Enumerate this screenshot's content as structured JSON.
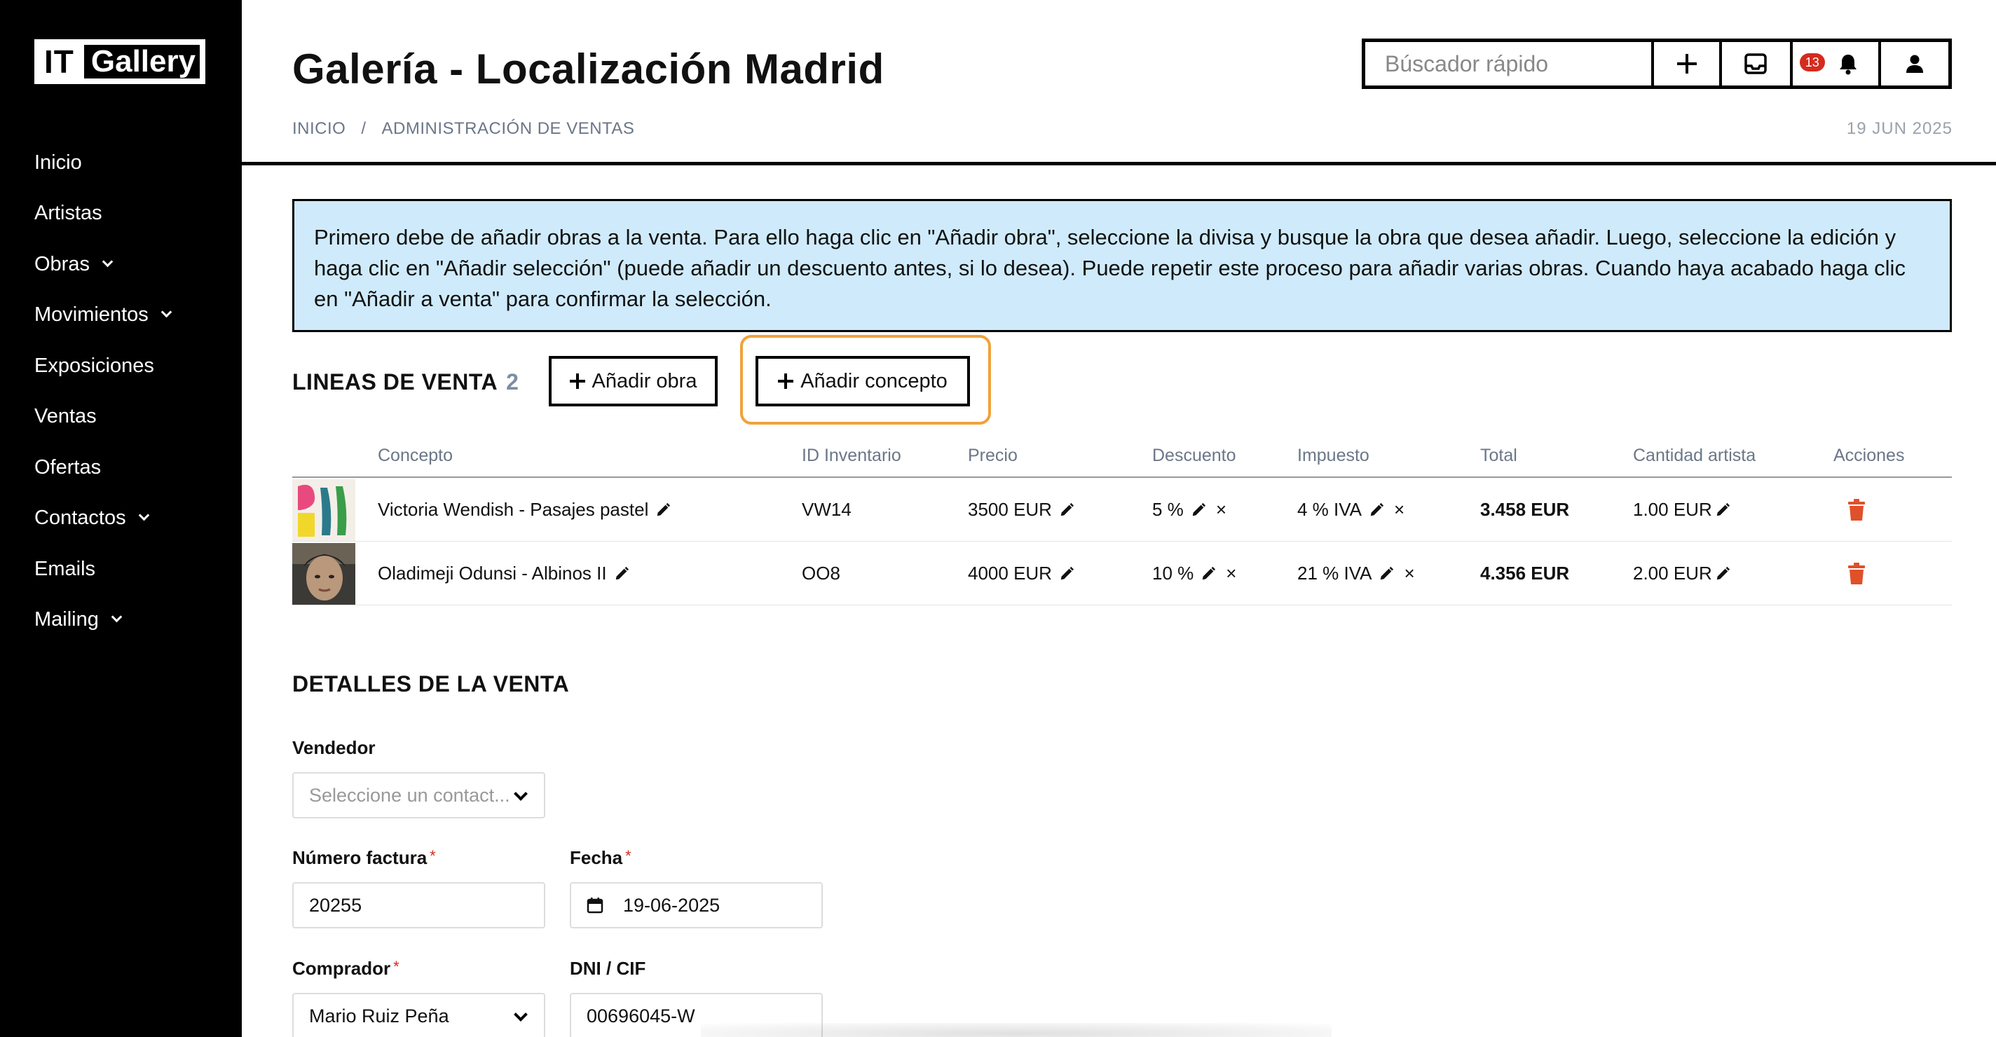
{
  "app": {
    "logo_it": "IT",
    "logo_gallery": "Gallery"
  },
  "sidebar": {
    "items": [
      {
        "label": "Inicio",
        "has_submenu": false
      },
      {
        "label": "Artistas",
        "has_submenu": false
      },
      {
        "label": "Obras",
        "has_submenu": true
      },
      {
        "label": "Movimientos",
        "has_submenu": true
      },
      {
        "label": "Exposiciones",
        "has_submenu": false
      },
      {
        "label": "Ventas",
        "has_submenu": false
      },
      {
        "label": "Ofertas",
        "has_submenu": false
      },
      {
        "label": "Contactos",
        "has_submenu": true
      },
      {
        "label": "Emails",
        "has_submenu": false
      },
      {
        "label": "Mailing",
        "has_submenu": true
      }
    ]
  },
  "header": {
    "title": "Galería - Localización Madrid",
    "breadcrumb": [
      "INICIO",
      "ADMINISTRACIÓN DE VENTAS"
    ],
    "breadcrumb_sep": "/",
    "date": "19 JUN 2025"
  },
  "topbar": {
    "search_placeholder": "Búscador rápido",
    "notifications_count": "13",
    "icons": [
      "plus-icon",
      "inbox-icon",
      "bell-icon",
      "user-icon"
    ]
  },
  "info_box": {
    "text": "Primero debe de añadir obras a la venta. Para ello haga clic en \"Añadir obra\", seleccione la divisa y busque la obra que desea añadir. Luego, seleccione la edición y haga clic en \"Añadir selección\" (puede añadir un descuento antes, si lo desea). Puede repetir este proceso para añadir varias obras. Cuando haya acabado haga clic en \"Añadir a venta\" para confirmar la selección."
  },
  "lines": {
    "title": "LINEAS DE VENTA",
    "count": "2",
    "add_work_label": "Añadir obra",
    "add_concept_label": "Añadir concepto",
    "columns": [
      "Concepto",
      "ID Inventario",
      "Precio",
      "Descuento",
      "Impuesto",
      "Total",
      "Cantidad artista",
      "Acciones"
    ],
    "rows": [
      {
        "concept": "Victoria Wendish - Pasajes pastel",
        "inventory_id": "VW14",
        "price": "3500 EUR",
        "discount": "5 %",
        "tax": "4 % IVA",
        "total": "3.458 EUR",
        "artist_amount": "1.00 EUR"
      },
      {
        "concept": "Oladimeji Odunsi - Albinos II",
        "inventory_id": "OO8",
        "price": "4000 EUR",
        "discount": "10 %",
        "tax": "21 % IVA",
        "total": "4.356 EUR",
        "artist_amount": "2.00 EUR"
      }
    ],
    "remove_symbol": "×"
  },
  "details": {
    "title": "DETALLES DE LA VENTA",
    "seller_label": "Vendedor",
    "seller_placeholder": "Seleccione un contact...",
    "invoice_label": "Número factura",
    "invoice_value": "20255",
    "date_label": "Fecha",
    "date_value": "19-06-2025",
    "buyer_label": "Comprador",
    "buyer_value": "Mario Ruiz Peña",
    "dni_label": "DNI / CIF",
    "dni_value": "00696045-W",
    "required_mark": "*"
  },
  "colors": {
    "sidebar_bg": "#000000",
    "info_bg": "#cfebfb",
    "focus_ring": "#f0a23b",
    "danger": "#e0502a",
    "badge": "#d52b1e"
  }
}
